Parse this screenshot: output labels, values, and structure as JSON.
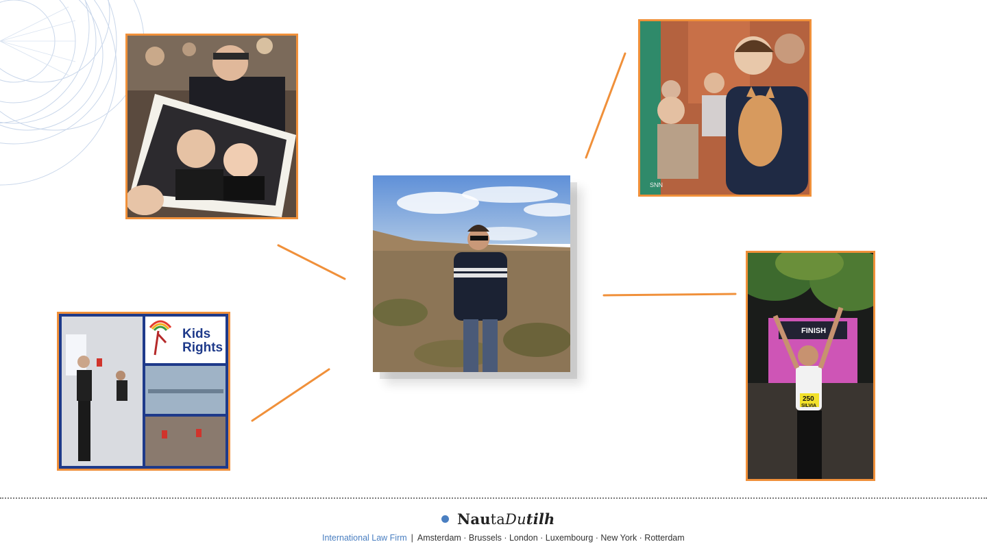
{
  "logo": {
    "part1": "Nau",
    "part2": "ta",
    "part3": "Du",
    "part4": "tilh"
  },
  "footer": {
    "firm_label": "International Law Firm",
    "separator": "|",
    "cities": "Amsterdam · Brussels · London · Luxembourg · New York · Rotterdam"
  },
  "photos": {
    "kids_rights_logo_line1": "Kids",
    "kids_rights_logo_line2": "Rights",
    "finish_sign": "FINISH",
    "bib_number": "250",
    "bib_name": "SILVIA",
    "watermark": "SNN"
  },
  "colors": {
    "accent_orange": "#f0903a",
    "brand_blue": "#4a7fc1",
    "kids_rights_navy": "#1e3a8a"
  }
}
